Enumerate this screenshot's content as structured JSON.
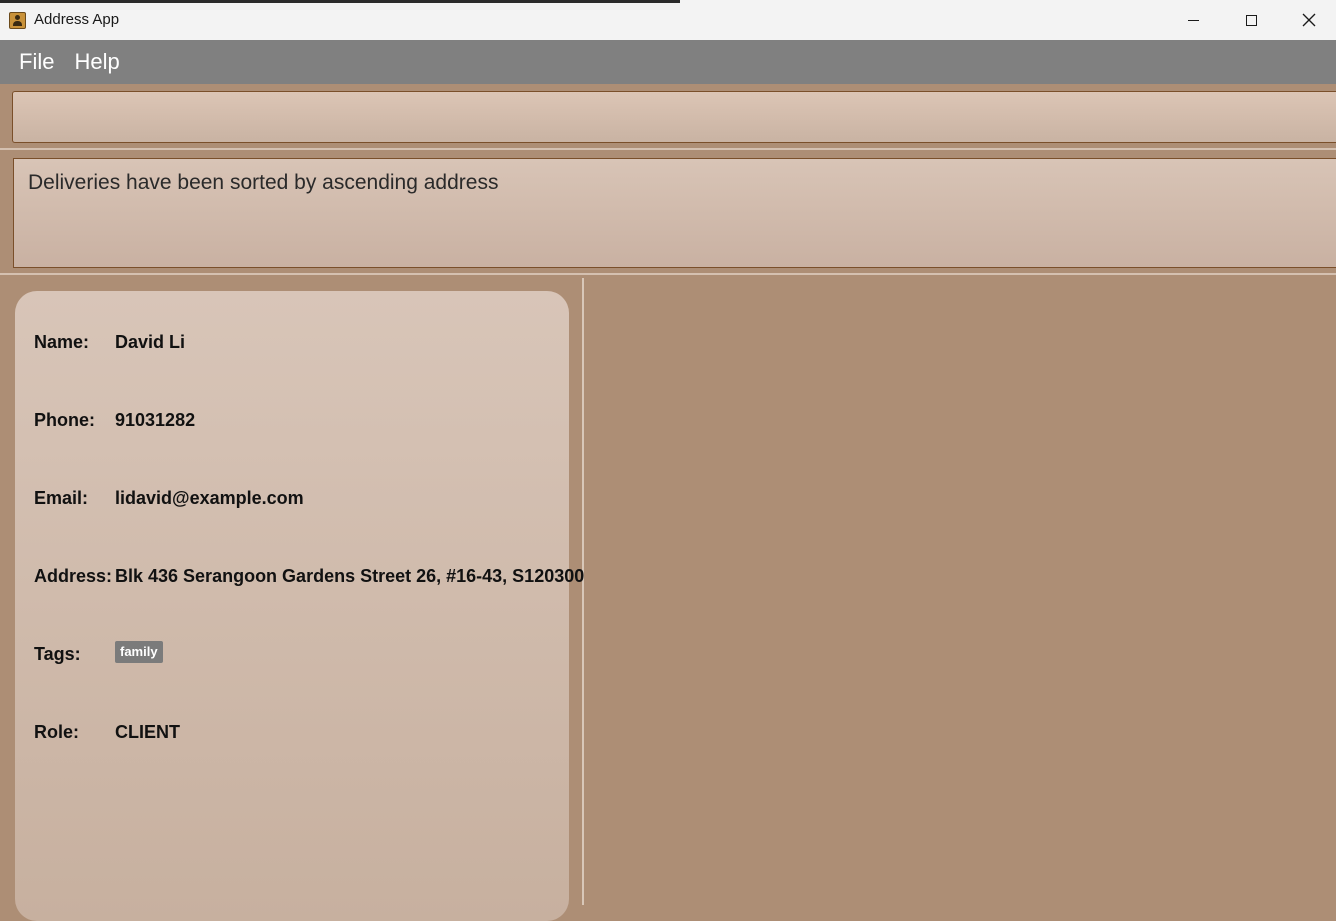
{
  "window": {
    "title": "Address App",
    "icon": "address-book-icon"
  },
  "menu": {
    "items": [
      "File",
      "Help"
    ]
  },
  "command_box": {
    "value": ""
  },
  "result": {
    "message": "Deliveries have been sorted by ascending address"
  },
  "person": {
    "labels": {
      "name": "Name:",
      "phone": "Phone:",
      "email": "Email:",
      "address": "Address:",
      "tags": "Tags:",
      "role": "Role:"
    },
    "name": "David Li",
    "phone": "91031282",
    "email": "lidavid@example.com",
    "address": "Blk 436 Serangoon Gardens Street 26, #16-43, S120300",
    "tags": [
      "family"
    ],
    "role": "CLIENT"
  },
  "colors": {
    "menubar": "#808080",
    "background": "#ad8e75",
    "tag": "#7b7b7b"
  }
}
